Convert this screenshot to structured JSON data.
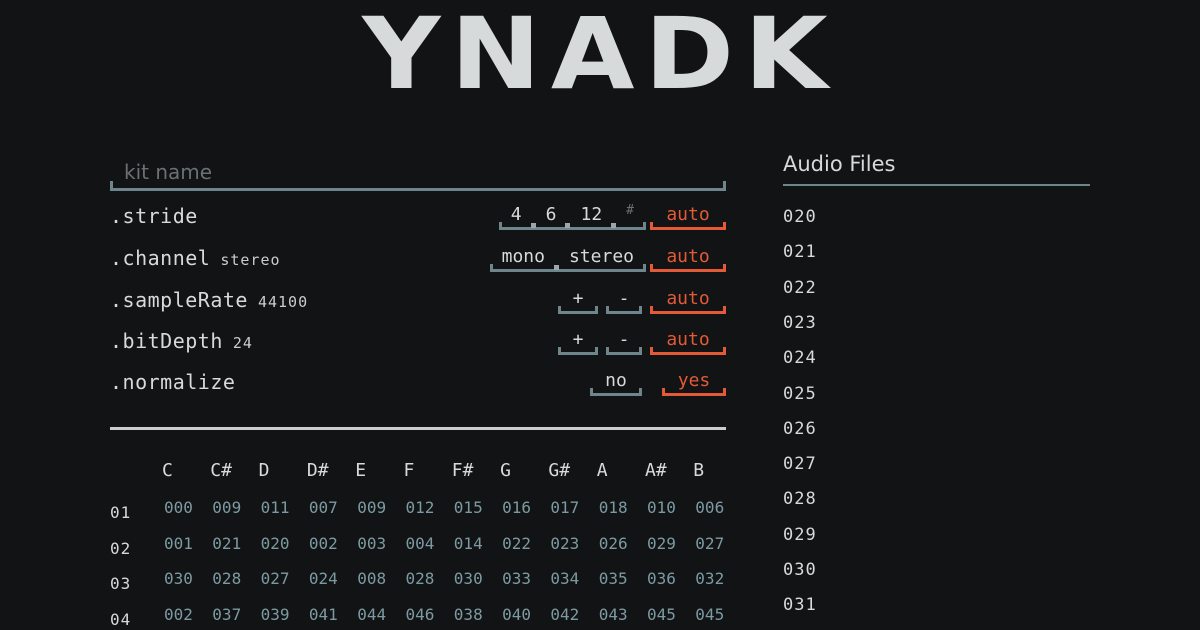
{
  "logo": "YNADK",
  "kit_name": {
    "placeholder": "kit name",
    "value": ""
  },
  "settings": [
    {
      "label": ".stride",
      "value": "",
      "options": [
        "4",
        "6",
        "12",
        "#"
      ],
      "auto": "auto"
    },
    {
      "label": ".channel",
      "value": "stereo",
      "options": [
        "mono",
        "stereo"
      ],
      "auto": "auto"
    },
    {
      "label": ".sampleRate",
      "value": "44100",
      "plus": "+",
      "minus": "-",
      "auto": "auto"
    },
    {
      "label": ".bitDepth",
      "value": "24",
      "plus": "+",
      "minus": "-",
      "auto": "auto"
    },
    {
      "label": ".normalize",
      "value": "",
      "no": "no",
      "yes": "yes"
    }
  ],
  "grid": {
    "notes": [
      "C",
      "C#",
      "D",
      "D#",
      "E",
      "F",
      "F#",
      "G",
      "G#",
      "A",
      "A#",
      "B"
    ],
    "rows": [
      {
        "label": "01",
        "cells": [
          "000",
          "009",
          "011",
          "007",
          "009",
          "012",
          "015",
          "016",
          "017",
          "018",
          "010",
          "006"
        ]
      },
      {
        "label": "02",
        "cells": [
          "001",
          "021",
          "020",
          "002",
          "003",
          "004",
          "014",
          "022",
          "023",
          "026",
          "029",
          "027"
        ]
      },
      {
        "label": "03",
        "cells": [
          "030",
          "028",
          "027",
          "024",
          "008",
          "028",
          "030",
          "033",
          "034",
          "035",
          "036",
          "032"
        ]
      },
      {
        "label": "04",
        "cells": [
          "002",
          "037",
          "039",
          "041",
          "044",
          "046",
          "038",
          "040",
          "042",
          "043",
          "045",
          "045"
        ]
      }
    ]
  },
  "audio_files": {
    "title": "Audio Files",
    "items": [
      "020",
      "021",
      "022",
      "023",
      "024",
      "025",
      "026",
      "027",
      "028",
      "029",
      "030",
      "031"
    ]
  },
  "colors": {
    "accent": "#e45a36",
    "steel": "#6f858c",
    "cell": "#7d9aa3",
    "bg": "#111314"
  }
}
